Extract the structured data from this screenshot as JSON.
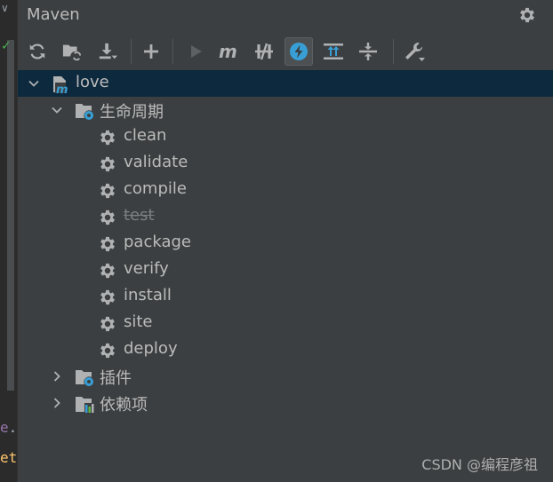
{
  "panel": {
    "title": "Maven"
  },
  "toolbar": {
    "buttons": [
      {
        "name": "reload-all-projects-button",
        "icon": "reload-icon",
        "active": false
      },
      {
        "name": "generate-sources-button",
        "icon": "folder-refresh-icon",
        "active": false
      },
      {
        "name": "download-sources-button",
        "icon": "download-icon",
        "active": false
      },
      {
        "name": "add-maven-project-button",
        "icon": "plus-icon",
        "active": false
      },
      {
        "name": "run-maven-build-button",
        "icon": "play-icon",
        "active": false,
        "disabled": true
      },
      {
        "name": "execute-maven-goal-button",
        "icon": "maven-m-icon",
        "active": false
      },
      {
        "name": "toggle-offline-mode-button",
        "icon": "offline-icon",
        "active": false
      },
      {
        "name": "toggle-skip-tests-button",
        "icon": "lightning-icon",
        "active": true
      },
      {
        "name": "show-dependencies-button",
        "icon": "show-diagram-icon",
        "active": false
      },
      {
        "name": "collapse-all-button",
        "icon": "collapse-all-icon",
        "active": false
      },
      {
        "name": "maven-settings-button",
        "icon": "wrench-icon",
        "active": false
      }
    ]
  },
  "tree": {
    "project": {
      "label": "love",
      "icon": "maven-project-icon",
      "expanded": true,
      "selected": true
    },
    "lifecycle": {
      "label": "生命周期",
      "icon": "lifecycle-folder-icon",
      "expanded": true,
      "goals": [
        {
          "label": "clean",
          "skipped": false
        },
        {
          "label": "validate",
          "skipped": false
        },
        {
          "label": "compile",
          "skipped": false
        },
        {
          "label": "test",
          "skipped": true
        },
        {
          "label": "package",
          "skipped": false
        },
        {
          "label": "verify",
          "skipped": false
        },
        {
          "label": "install",
          "skipped": false
        },
        {
          "label": "site",
          "skipped": false
        },
        {
          "label": "deploy",
          "skipped": false
        }
      ]
    },
    "plugins": {
      "label": "插件",
      "icon": "plugins-folder-icon",
      "expanded": false
    },
    "dependencies": {
      "label": "依赖项",
      "icon": "dependencies-folder-icon",
      "expanded": false
    }
  },
  "editor_fragments": {
    "line1_a": "e",
    "line1_b": ".",
    "line2": "et"
  },
  "watermark": "CSDN @编程彦祖",
  "colors": {
    "background": "#3c3f41",
    "selection": "#0d293e",
    "accent": "#389fd6",
    "text": "#bbbbbb"
  }
}
